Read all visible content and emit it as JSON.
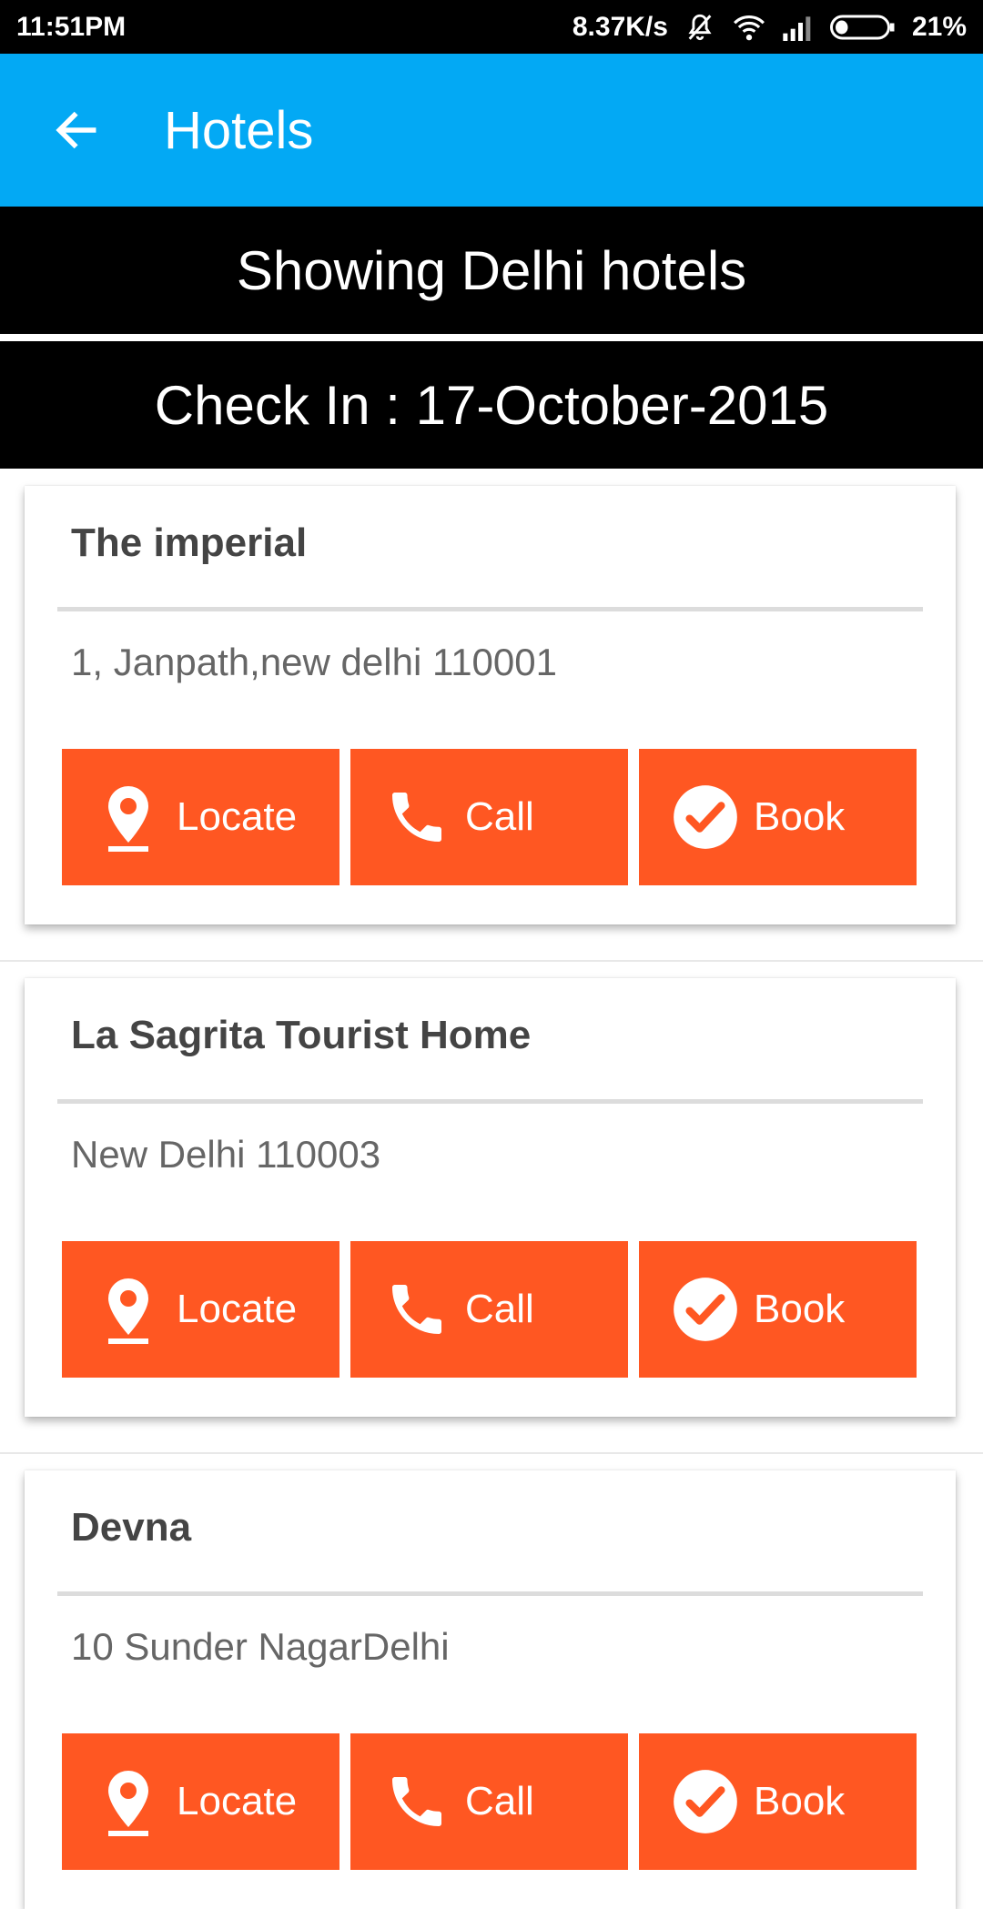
{
  "status_bar": {
    "time": "11:51PM",
    "net_speed": "8.37K/s",
    "battery": "21%",
    "icons": [
      "mute-icon",
      "wifi-icon",
      "signal-icon",
      "battery-icon"
    ]
  },
  "app_bar": {
    "title": "Hotels",
    "back_icon": "arrow-left-icon",
    "color": "#03A9F4"
  },
  "banner": {
    "city_text": "Showing Delhi hotels",
    "checkin_text": "Check In : 17-October-2015"
  },
  "accent": "#FF5722",
  "hotels": [
    {
      "name": "The imperial",
      "address": "1, Janpath,new delhi 110001",
      "locate": "Locate",
      "call": "Call",
      "book": "Book"
    },
    {
      "name": "La Sagrita Tourist Home",
      "address": "New Delhi 110003",
      "locate": "Locate",
      "call": "Call",
      "book": "Book"
    },
    {
      "name": "Devna",
      "address": "10 Sunder NagarDelhi",
      "locate": "Locate",
      "call": "Call",
      "book": "Book"
    }
  ]
}
